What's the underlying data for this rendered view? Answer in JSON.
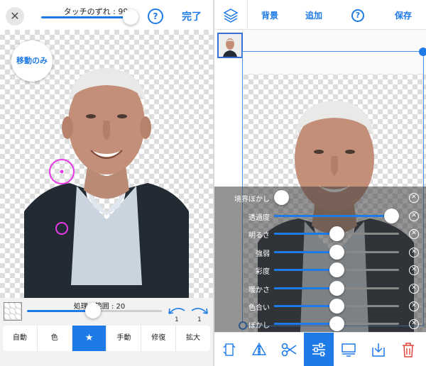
{
  "left_panel": {
    "close_label": "✕",
    "touch_offset_label": "タッチのずれ : 99",
    "touch_offset_value": 99,
    "help_label": "?",
    "done_label": "完了",
    "move_only_label": "移動のみ",
    "processing_label": "処理の範囲 : 20",
    "processing_value": 20,
    "rotate_left_count": "1",
    "rotate_right_count": "1",
    "tabs": [
      {
        "label": "自動",
        "active": false
      },
      {
        "label": "色",
        "active": false
      },
      {
        "label": "★",
        "active": true
      },
      {
        "label": "手動",
        "active": false
      },
      {
        "label": "修復",
        "active": false
      },
      {
        "label": "拡大",
        "active": false
      }
    ]
  },
  "right_panel": {
    "top_bar": {
      "background_label": "背景",
      "add_label": "追加",
      "help_label": "?",
      "save_label": "保存"
    },
    "adjustments": [
      {
        "label": "境界ぼかし",
        "value": 0.0
      },
      {
        "label": "透過度",
        "value": 1.0
      },
      {
        "label": "明るさ",
        "value": 0.5
      },
      {
        "label": "強弱",
        "value": 0.5
      },
      {
        "label": "彩度",
        "value": 0.5
      },
      {
        "label": "暖かさ",
        "value": 0.5
      },
      {
        "label": "色合い",
        "value": 0.5
      },
      {
        "label": "ぼかし",
        "value": 0.5
      }
    ],
    "toolbar_icons": [
      "flip-swap-icon",
      "mirror-icon",
      "scissors-icon",
      "sliders-icon",
      "monitor-icon",
      "download-icon",
      "trash-icon"
    ],
    "active_tool": "sliders-icon"
  },
  "colors": {
    "accent": "#1e7ae6",
    "delete": "#e0453a",
    "brush_circle": "#e838e8"
  }
}
